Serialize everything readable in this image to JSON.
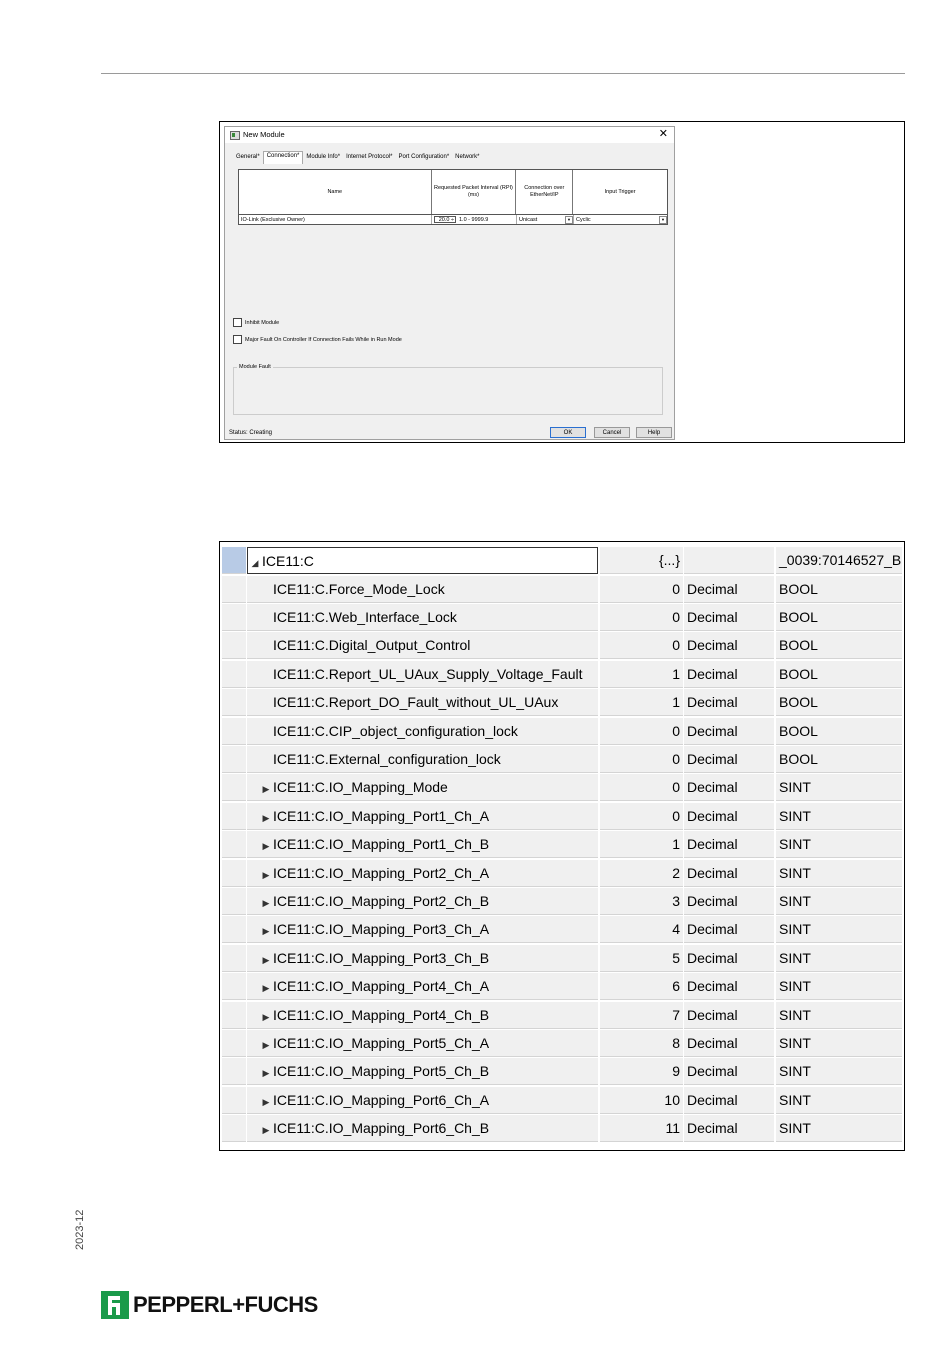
{
  "dialog": {
    "title": "New Module",
    "close": "✕",
    "tabs": [
      "General*",
      "Connection*",
      "Module Info*",
      "Internet Protocol*",
      "Port Configuration*",
      "Network*"
    ],
    "columns": {
      "name": "Name",
      "rpi": "Requested Packet Interval (RPI) (ms)",
      "conn": "Connection over EtherNet/IP",
      "trigger": "Input Trigger"
    },
    "row": {
      "name": "IO-Link (Exclusive Owner)",
      "rpi_value": "20.0",
      "rpi_range": "1.0 - 9999.9",
      "conn": "Unicast",
      "trigger": "Cyclic"
    },
    "inhibit_label": "Inhibit Module",
    "major_fault_label": "Major Fault On Controller If Connection Fails While in Run Mode",
    "module_fault_label": "Module Fault",
    "status": "Status: Creating",
    "ok": "OK",
    "cancel": "Cancel",
    "help": "Help"
  },
  "tags": {
    "header": {
      "toggle": "◢",
      "name": "ICE11:C",
      "value": "{...}",
      "style": "",
      "type": "_0039:70146527_B..."
    },
    "rows": [
      {
        "toggle": "",
        "name": "ICE11:C.Force_Mode_Lock",
        "value": "0",
        "style": "Decimal",
        "type": "BOOL"
      },
      {
        "toggle": "",
        "name": "ICE11:C.Web_Interface_Lock",
        "value": "0",
        "style": "Decimal",
        "type": "BOOL"
      },
      {
        "toggle": "",
        "name": "ICE11:C.Digital_Output_Control",
        "value": "0",
        "style": "Decimal",
        "type": "BOOL"
      },
      {
        "toggle": "",
        "name": "ICE11:C.Report_UL_UAux_Supply_Voltage_Fault",
        "value": "1",
        "style": "Decimal",
        "type": "BOOL"
      },
      {
        "toggle": "",
        "name": "ICE11:C.Report_DO_Fault_without_UL_UAux",
        "value": "1",
        "style": "Decimal",
        "type": "BOOL"
      },
      {
        "toggle": "",
        "name": "ICE11:C.CIP_object_configuration_lock",
        "value": "0",
        "style": "Decimal",
        "type": "BOOL"
      },
      {
        "toggle": "",
        "name": "ICE11:C.External_configuration_lock",
        "value": "0",
        "style": "Decimal",
        "type": "BOOL"
      },
      {
        "toggle": "▶",
        "name": "ICE11:C.IO_Mapping_Mode",
        "value": "0",
        "style": "Decimal",
        "type": "SINT"
      },
      {
        "toggle": "▶",
        "name": "ICE11:C.IO_Mapping_Port1_Ch_A",
        "value": "0",
        "style": "Decimal",
        "type": "SINT"
      },
      {
        "toggle": "▶",
        "name": "ICE11:C.IO_Mapping_Port1_Ch_B",
        "value": "1",
        "style": "Decimal",
        "type": "SINT"
      },
      {
        "toggle": "▶",
        "name": "ICE11:C.IO_Mapping_Port2_Ch_A",
        "value": "2",
        "style": "Decimal",
        "type": "SINT"
      },
      {
        "toggle": "▶",
        "name": "ICE11:C.IO_Mapping_Port2_Ch_B",
        "value": "3",
        "style": "Decimal",
        "type": "SINT"
      },
      {
        "toggle": "▶",
        "name": "ICE11:C.IO_Mapping_Port3_Ch_A",
        "value": "4",
        "style": "Decimal",
        "type": "SINT"
      },
      {
        "toggle": "▶",
        "name": "ICE11:C.IO_Mapping_Port3_Ch_B",
        "value": "5",
        "style": "Decimal",
        "type": "SINT"
      },
      {
        "toggle": "▶",
        "name": "ICE11:C.IO_Mapping_Port4_Ch_A",
        "value": "6",
        "style": "Decimal",
        "type": "SINT"
      },
      {
        "toggle": "▶",
        "name": "ICE11:C.IO_Mapping_Port4_Ch_B",
        "value": "7",
        "style": "Decimal",
        "type": "SINT"
      },
      {
        "toggle": "▶",
        "name": "ICE11:C.IO_Mapping_Port5_Ch_A",
        "value": "8",
        "style": "Decimal",
        "type": "SINT"
      },
      {
        "toggle": "▶",
        "name": "ICE11:C.IO_Mapping_Port5_Ch_B",
        "value": "9",
        "style": "Decimal",
        "type": "SINT"
      },
      {
        "toggle": "▶",
        "name": "ICE11:C.IO_Mapping_Port6_Ch_A",
        "value": "10",
        "style": "Decimal",
        "type": "SINT"
      },
      {
        "toggle": "▶",
        "name": "ICE11:C.IO_Mapping_Port6_Ch_B",
        "value": "11",
        "style": "Decimal",
        "type": "SINT"
      }
    ]
  },
  "footer": {
    "date": "2023-12",
    "logo_text": "PEPPERL+FUCHS",
    "logo_color": "#1a9a4a"
  }
}
